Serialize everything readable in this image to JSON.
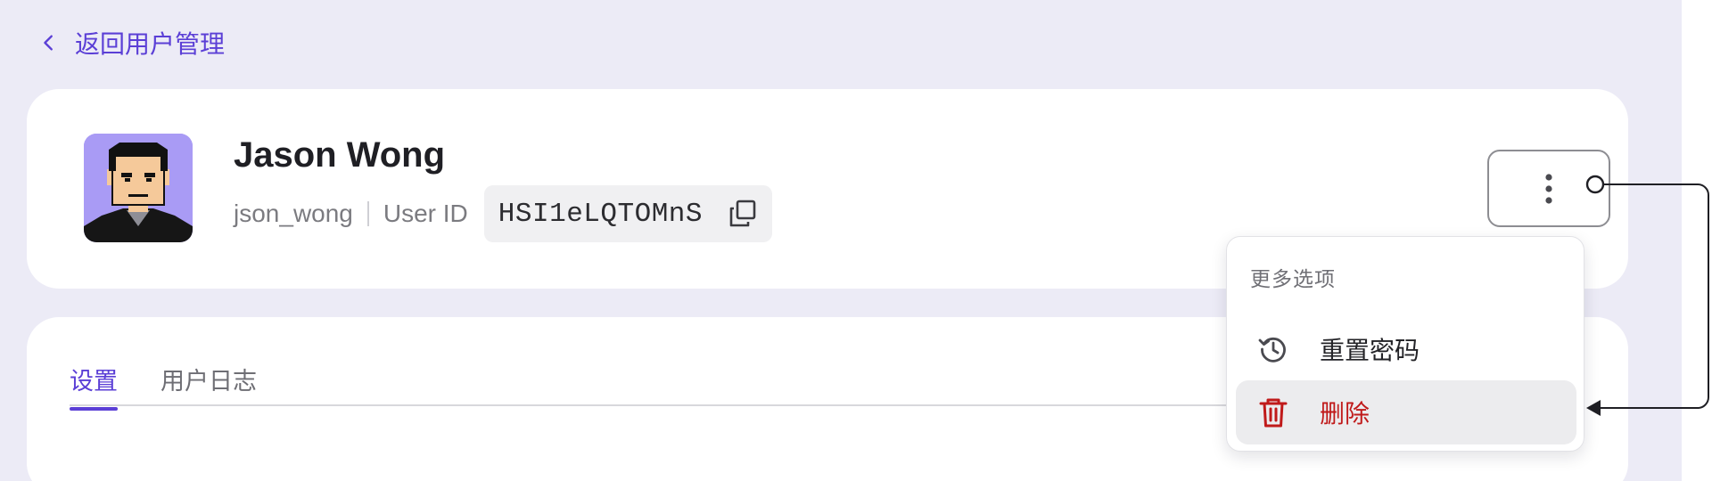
{
  "nav": {
    "back_label": "返回用户管理"
  },
  "profile": {
    "name": "Jason Wong",
    "username": "json_wong",
    "user_id_label": "User ID",
    "user_id": "HSI1eLQTOMnS"
  },
  "tabs": [
    {
      "label": "设置",
      "active": true
    },
    {
      "label": "用户日志",
      "active": false
    }
  ],
  "more_menu": {
    "header": "更多选项",
    "items": [
      {
        "label": "重置密码",
        "icon": "reset-history-icon"
      },
      {
        "label": "删除",
        "icon": "trash-icon",
        "danger": true,
        "hovered": true
      }
    ]
  },
  "colors": {
    "accent": "#5b3fd6",
    "danger": "#c01a1a",
    "page_bg": "#ecebf6",
    "avatar_bg": "#a99bf5"
  }
}
